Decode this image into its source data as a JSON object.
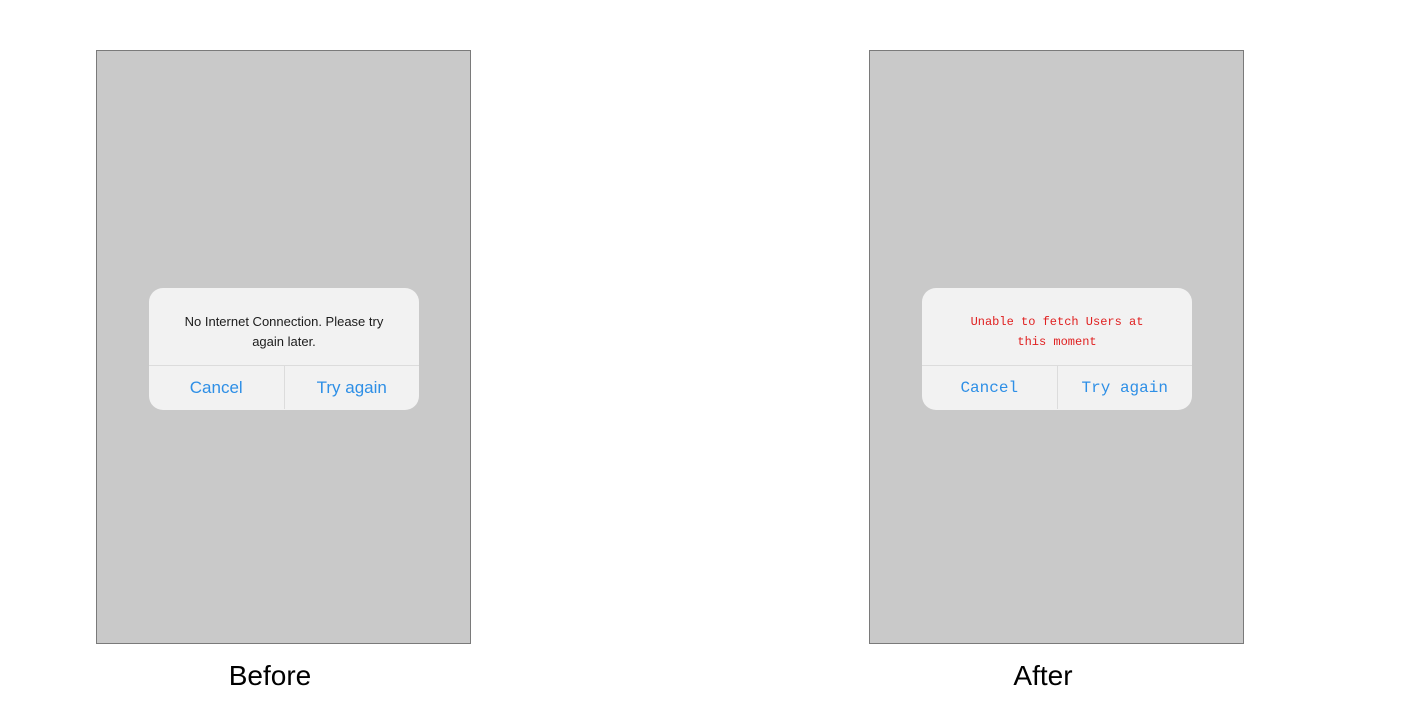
{
  "before": {
    "caption": "Before",
    "alert": {
      "message": "No Internet Connection. Please try again later.",
      "cancel_label": "Cancel",
      "retry_label": "Try again"
    }
  },
  "after": {
    "caption": "After",
    "alert": {
      "message": "Unable to fetch Users at this moment",
      "cancel_label": "Cancel",
      "retry_label": "Try again"
    }
  },
  "colors": {
    "screen_background": "#c9c9c9",
    "alert_background": "#f2f2f2",
    "button_text": "#2e8fe6",
    "before_message_text": "#1c1c1c",
    "after_message_text": "#e02020"
  }
}
